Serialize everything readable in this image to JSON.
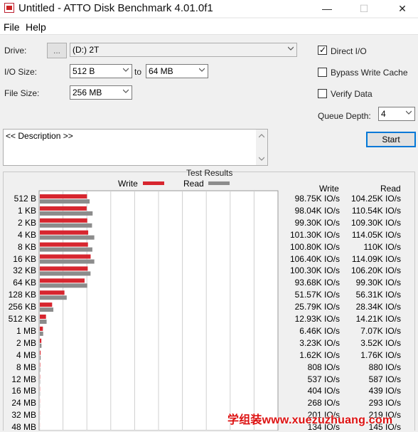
{
  "window": {
    "title": "Untitled - ATTO Disk Benchmark 4.01.0f1",
    "minimize": "—",
    "maximize": "☐",
    "close": "✕"
  },
  "menu": {
    "file": "File",
    "help": "Help"
  },
  "form": {
    "drive_label": "Drive:",
    "browse_label": "...",
    "drive_value": "(D:) 2T",
    "io_size_label": "I/O Size:",
    "io_from": "512 B",
    "to_label": "to",
    "io_to": "64 MB",
    "file_size_label": "File Size:",
    "file_size": "256 MB",
    "direct_io_label": "Direct I/O",
    "direct_io": true,
    "bypass_label": "Bypass Write Cache",
    "bypass": false,
    "verify_label": "Verify Data",
    "verify": false,
    "queue_label": "Queue Depth:",
    "queue_depth": "4",
    "start_label": "Start",
    "description": "<< Description >>"
  },
  "results": {
    "title": "Test Results",
    "write_label": "Write",
    "read_label": "Read",
    "col_write": "Write",
    "col_read": "Read",
    "colors": {
      "write": "#d7262f",
      "read": "#8c8c8c"
    }
  },
  "chart_data": {
    "type": "bar",
    "orientation": "horizontal",
    "title": "Test Results",
    "categories": [
      "512 B",
      "1 KB",
      "2 KB",
      "4 KB",
      "8 KB",
      "16 KB",
      "32 KB",
      "64 KB",
      "128 KB",
      "256 KB",
      "512 KB",
      "1 MB",
      "2 MB",
      "4 MB",
      "8 MB",
      "12 MB",
      "16 MB",
      "24 MB",
      "32 MB",
      "48 MB"
    ],
    "series": [
      {
        "name": "Write",
        "values": [
          98.75,
          98.04,
          99.3,
          101.3,
          100.8,
          106.4,
          100.3,
          93.68,
          51.57,
          25.79,
          12.93,
          6.46,
          3.23,
          1.62,
          0.808,
          0.537,
          0.404,
          0.268,
          0.201,
          0.134
        ],
        "labels": [
          "98.75K IO/s",
          "98.04K IO/s",
          "99.30K IO/s",
          "101.30K IO/s",
          "100.80K IO/s",
          "106.40K IO/s",
          "100.30K IO/s",
          "93.68K IO/s",
          "51.57K IO/s",
          "25.79K IO/s",
          "12.93K IO/s",
          "6.46K IO/s",
          "3.23K IO/s",
          "1.62K IO/s",
          "808 IO/s",
          "537 IO/s",
          "404 IO/s",
          "268 IO/s",
          "201 IO/s",
          "134 IO/s"
        ]
      },
      {
        "name": "Read",
        "values": [
          104.25,
          110.54,
          109.3,
          114.05,
          110.0,
          114.09,
          106.2,
          99.3,
          56.31,
          28.34,
          14.21,
          7.07,
          3.52,
          1.76,
          0.88,
          0.587,
          0.439,
          0.293,
          0.219,
          0.145
        ],
        "labels": [
          "104.25K IO/s",
          "110.54K IO/s",
          "109.30K IO/s",
          "114.05K IO/s",
          "110K IO/s",
          "114.09K IO/s",
          "106.20K IO/s",
          "99.30K IO/s",
          "56.31K IO/s",
          "28.34K IO/s",
          "14.21K IO/s",
          "7.07K IO/s",
          "3.52K IO/s",
          "1.76K IO/s",
          "880 IO/s",
          "587 IO/s",
          "439 IO/s",
          "293 IO/s",
          "219 IO/s",
          "145 IO/s"
        ]
      }
    ],
    "value_unit": "K IO/s",
    "xlim": [
      0,
      500
    ],
    "grid": true,
    "legend": "top"
  },
  "watermark": "学组装www.xuezuzhuang.com"
}
